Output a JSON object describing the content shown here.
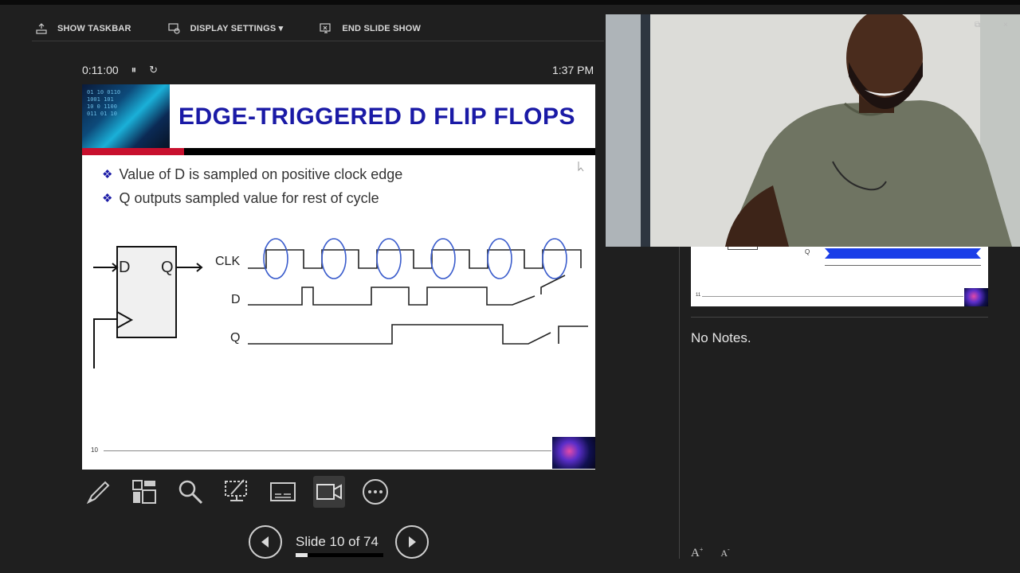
{
  "toolbar": {
    "show_taskbar": "SHOW TASKBAR",
    "display_settings": "DISPLAY SETTINGS ▾",
    "end_slide_show": "END SLIDE SHOW"
  },
  "timer": {
    "elapsed": "0:11:00",
    "pause_glyph": "⏸",
    "reset_glyph": "↻"
  },
  "clock": "1:37 PM",
  "slide": {
    "banner_binary": "01 10 0110\n1001 101\n10 0 1100\n011 01 10",
    "title": "EDGE-TRIGGERED D FLIP FLOPS",
    "bullets": [
      "Value of D is sampled on positive clock edge",
      "Q outputs sampled value for rest of cycle"
    ],
    "bullet_marker": "❖",
    "diagram": {
      "ff_input_label": "D",
      "ff_output_label": "Q",
      "signal_clk": "CLK",
      "signal_d": "D",
      "signal_q": "Q"
    },
    "footer_number": "10"
  },
  "navigation": {
    "slide_count": "Slide 10 of 74",
    "progress_fraction": 0.135
  },
  "next_slide_preview": {
    "label_q": "Q",
    "footer_number": "11"
  },
  "notes": {
    "text": "No Notes."
  },
  "font_controls": {
    "increase": "A",
    "decrease": "A"
  },
  "window_controls": {
    "restore": "⧉",
    "close": "×"
  },
  "colors": {
    "title_blue": "#1a1aa6",
    "accent_red": "#c8102e",
    "wave_blue": "#1a3ee8",
    "background": "#1f1f1f"
  },
  "icons": {
    "tools": [
      "pen-icon",
      "slides-grid-icon",
      "zoom-icon",
      "pointer-options-icon",
      "subtitles-icon",
      "camera-icon",
      "more-icon"
    ]
  }
}
